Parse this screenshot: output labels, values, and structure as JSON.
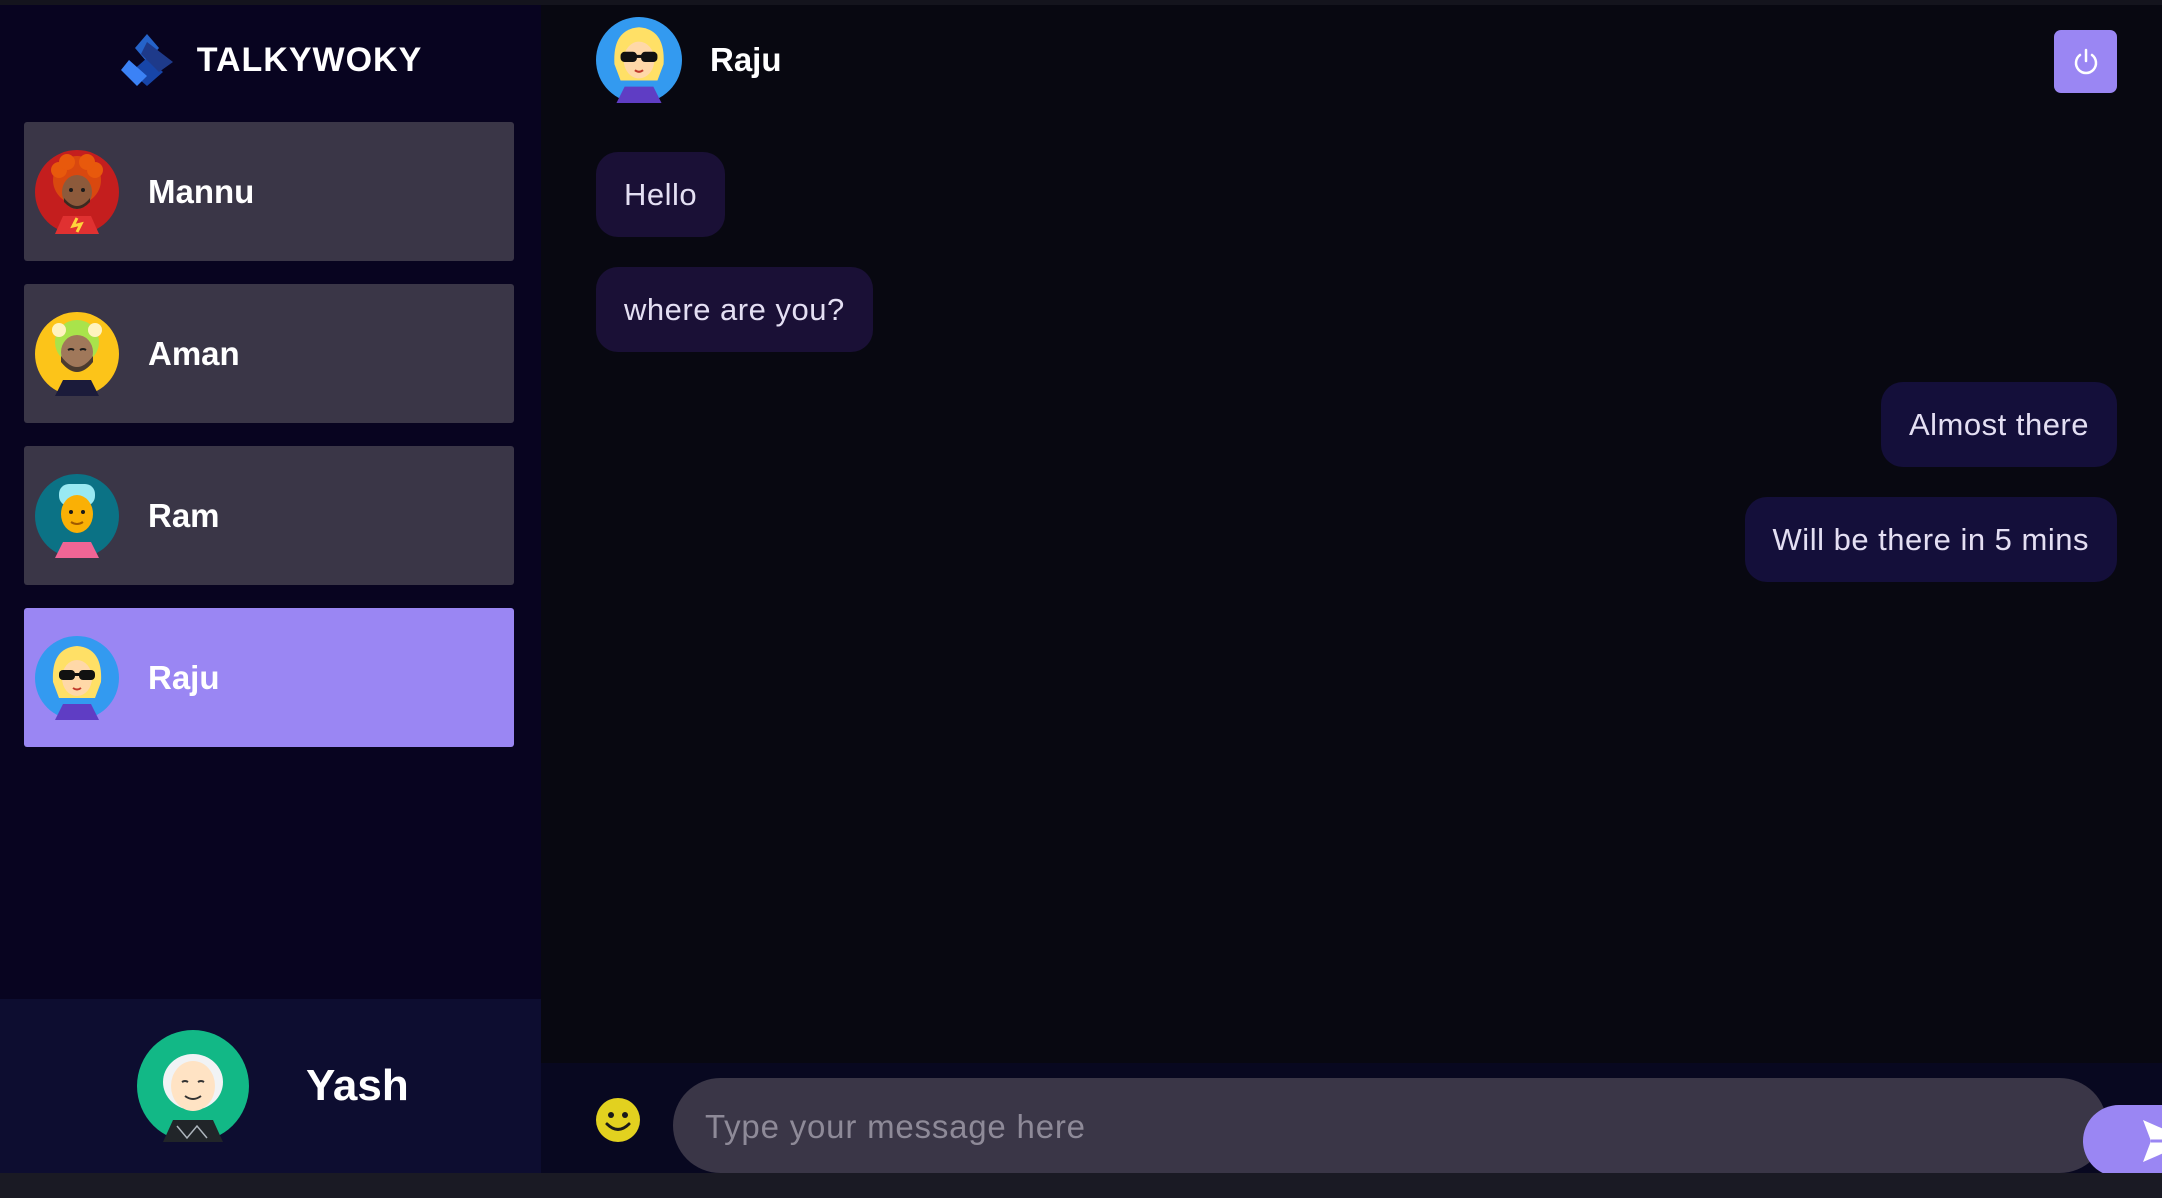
{
  "app": {
    "brand_name": "TALKYWOKY",
    "brand_icon": "diamond-logo-icon"
  },
  "sidebar": {
    "contacts": [
      {
        "label": "Mannu",
        "avatar": "avatar-red-curly-hair",
        "selected": false
      },
      {
        "label": "Aman",
        "avatar": "avatar-yellow-bearded",
        "selected": false
      },
      {
        "label": "Ram",
        "avatar": "avatar-teal-bald",
        "selected": false
      },
      {
        "label": "Raju",
        "avatar": "avatar-blonde-sunglasses",
        "selected": true
      }
    ],
    "current_user": {
      "label": "Yash",
      "avatar": "avatar-teal-elder"
    }
  },
  "chat": {
    "contact_name": "Raju",
    "logout_icon": "power-icon",
    "messages": [
      {
        "text": "Hello",
        "direction": "received"
      },
      {
        "text": "where are you?",
        "direction": "received"
      },
      {
        "text": "Almost there",
        "direction": "sent"
      },
      {
        "text": "Will be there in 5 mins",
        "direction": "sent"
      }
    ],
    "composer": {
      "placeholder": "Type your message here",
      "value": "",
      "emoji_icon": "smiley-icon",
      "send_icon": "send-arrow-icon"
    }
  },
  "colors": {
    "accent": "#9a86f3",
    "sidebar_bg": "#080420",
    "chat_bg": "#080811",
    "contact_bg": "#3a3647",
    "bubble_bg": "#1a1036"
  }
}
